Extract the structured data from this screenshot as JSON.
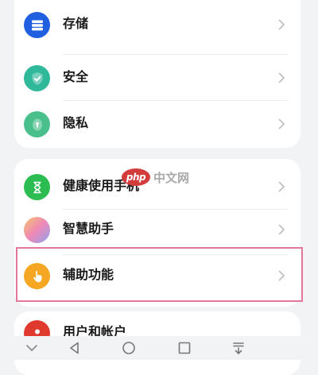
{
  "settings": {
    "group1": [
      {
        "label": "存储",
        "icon": "storage-icon",
        "color": "#1f5fe0"
      },
      {
        "label": "安全",
        "icon": "shield-check-icon",
        "color": "#2fb89a"
      },
      {
        "label": "隐私",
        "icon": "privacy-lock-icon",
        "color": "#49bf8c"
      }
    ],
    "group2": [
      {
        "label": "健康使用手机",
        "icon": "hourglass-icon",
        "color": "#2cbd52"
      },
      {
        "label": "智慧助手",
        "icon": "smart-assistant-icon",
        "color": "#d88ad0"
      },
      {
        "label": "辅助功能",
        "icon": "hand-pointer-icon",
        "color": "#f5a623"
      }
    ],
    "group3": [
      {
        "label": "用户和帐户",
        "icon": "user-account-icon",
        "color": "#e03a2f"
      }
    ]
  },
  "watermark": {
    "badge": "php",
    "text": "中文网"
  },
  "navbar": {
    "icons": [
      "chevron-down-icon",
      "back-icon",
      "home-icon",
      "recents-icon",
      "notification-pull-icon"
    ]
  },
  "highlight_color": "#e5779c"
}
